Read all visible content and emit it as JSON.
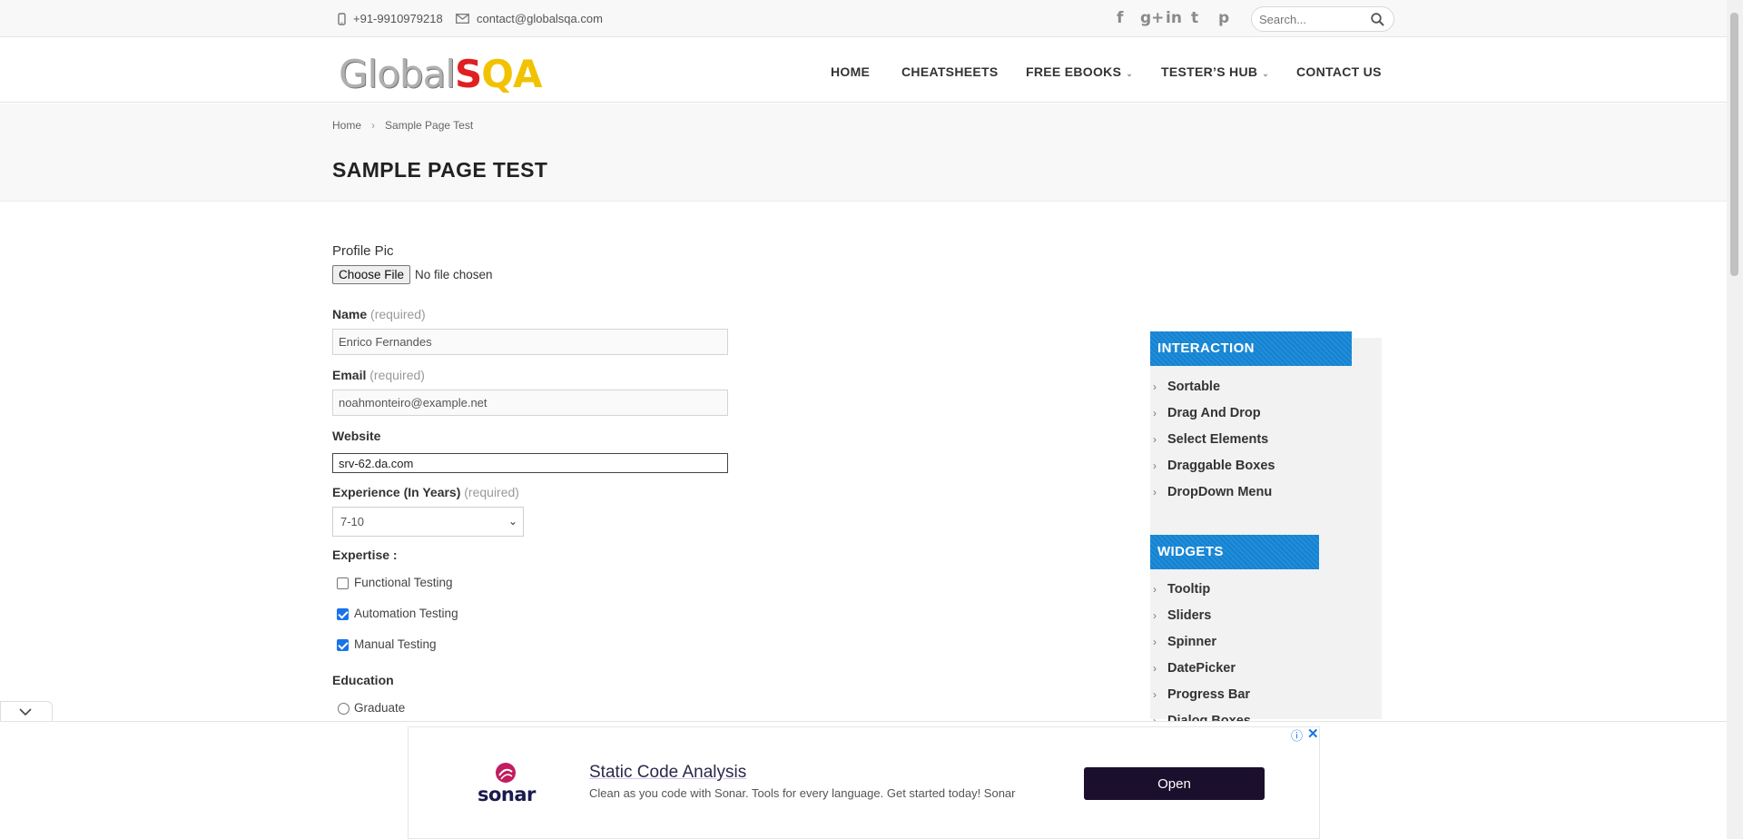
{
  "topbar": {
    "phone": "+91-9910979218",
    "email": "contact@globalsqa.com",
    "search_placeholder": "Search...",
    "social": [
      {
        "name": "facebook-icon",
        "glyph": "f"
      },
      {
        "name": "google-plus-icon",
        "glyph": "g+"
      },
      {
        "name": "linkedin-icon",
        "glyph": "in"
      },
      {
        "name": "twitter-icon",
        "glyph": "t"
      },
      {
        "name": "pinterest-icon",
        "glyph": "p"
      }
    ]
  },
  "header": {
    "logo": {
      "part1": "Global",
      "part2": "S",
      "part3": "QA"
    },
    "nav": {
      "home": "HOME",
      "cheatsheets": "CHEATSHEETS",
      "free_ebooks": "FREE EBOOKS",
      "testers_hub": "TESTER’S HUB",
      "contact_us": "CONTACT US"
    }
  },
  "breadcrumb": {
    "home": "Home",
    "separator": "›",
    "current": "Sample Page Test"
  },
  "page_title": "SAMPLE PAGE TEST",
  "form": {
    "profile_pic_label": "Profile Pic",
    "choose_file_label": "Choose File",
    "no_file_text": "No file chosen",
    "name_label": "Name",
    "name_required": "(required)",
    "name_value": "Enrico Fernandes",
    "email_label": "Email",
    "email_required": "(required)",
    "email_value": "noahmonteiro@example.net",
    "website_label": "Website",
    "website_value": "srv-62.da.com",
    "experience_label": "Experience (In Years)",
    "experience_required": "(required)",
    "experience_value": "7-10",
    "expertise_label": "Expertise :",
    "expertise": [
      {
        "label": "Functional Testing",
        "checked": false
      },
      {
        "label": "Automation Testing",
        "checked": true
      },
      {
        "label": "Manual Testing",
        "checked": true
      }
    ],
    "education_label": "Education",
    "education_options": [
      {
        "label": "Graduate",
        "selected": false
      }
    ]
  },
  "sidebar": {
    "interaction_title": "INTERACTION",
    "interaction_items": [
      "Sortable",
      "Drag And Drop",
      "Select Elements",
      "Draggable Boxes",
      "DropDown Menu"
    ],
    "widgets_title": "WIDGETS",
    "widgets_items": [
      "Tooltip",
      "Sliders",
      "Spinner",
      "DatePicker",
      "Progress Bar",
      "Dialog Boxes"
    ]
  },
  "ad": {
    "brand": "sonar",
    "title": "Static Code Analysis",
    "text": "Clean as you code with Sonar. Tools for every language. Get started today! Sonar",
    "button": "Open",
    "info_glyph": "ⓘ",
    "close_glyph": "✕"
  },
  "colors": {
    "widget_header": "#1283d3",
    "ad_button": "#1b0f2e",
    "checkbox_on": "#1a73e8",
    "logo_red": "#e02020",
    "logo_yellow": "#f2c200"
  }
}
